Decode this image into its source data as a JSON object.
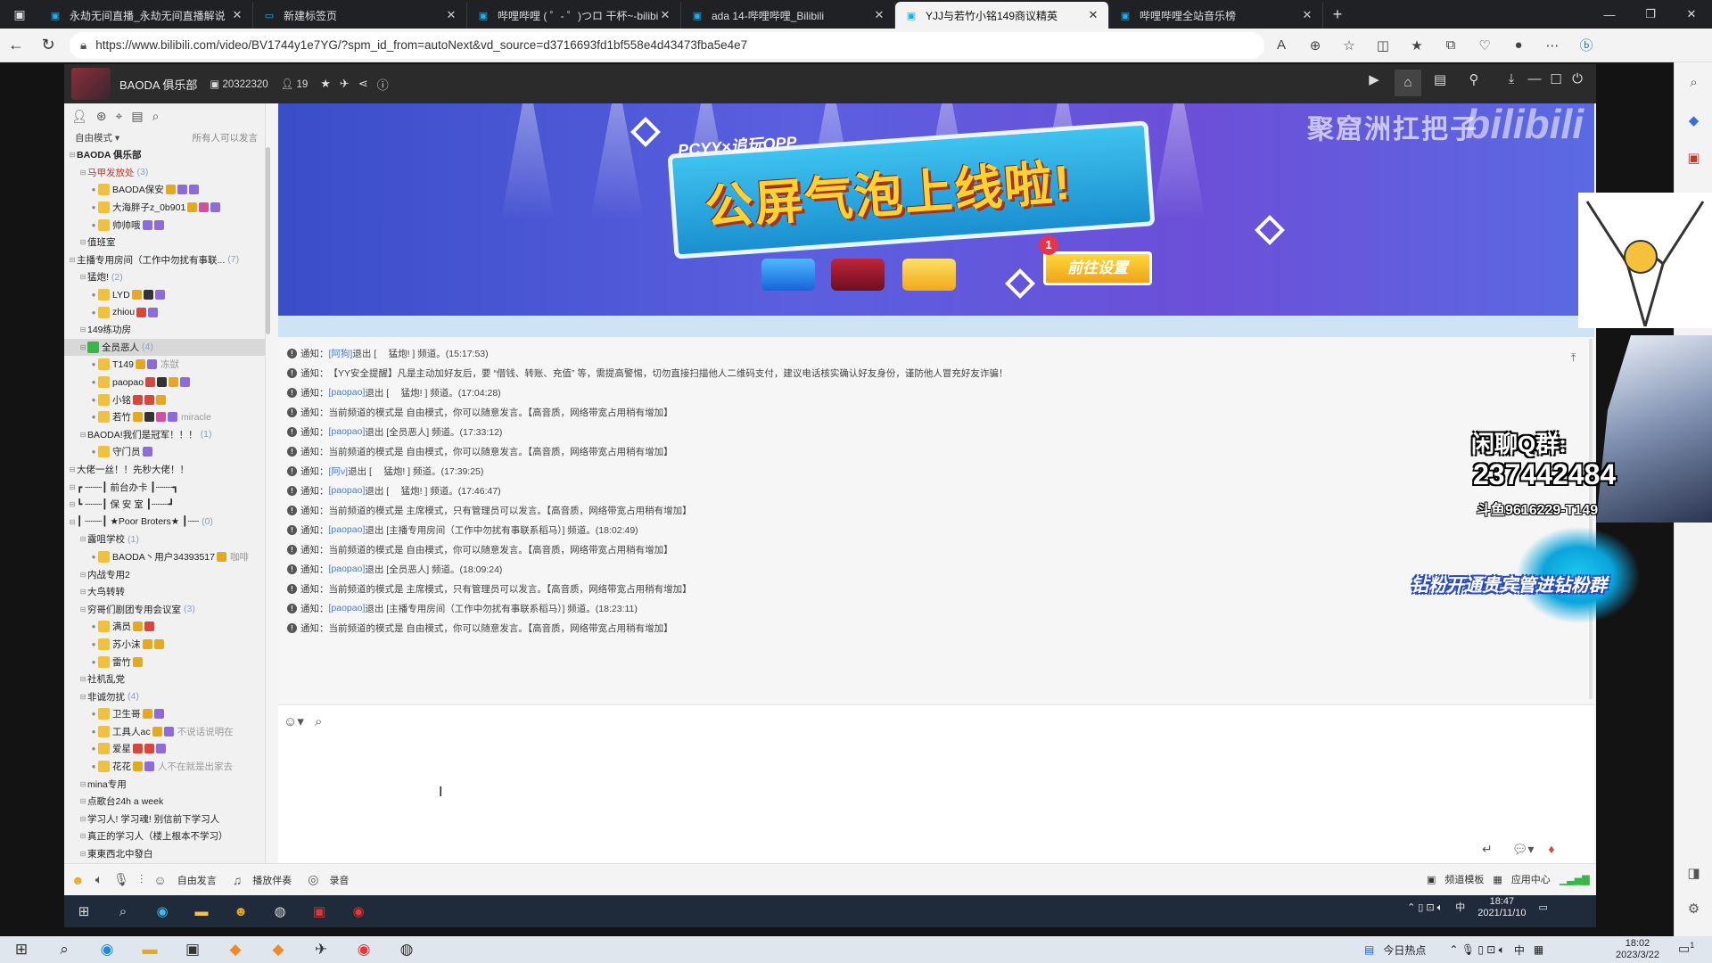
{
  "browser": {
    "tabs": [
      {
        "title": "永劫无间直播_永劫无间直播解说",
        "active": false
      },
      {
        "title": "新建标签页",
        "active": false
      },
      {
        "title": "哔哩哔哩 ( ゜- ゜)つロ 干杯~-bilibili",
        "active": false
      },
      {
        "title": "ada 14-哔哩哔哩_Bilibili",
        "active": false
      },
      {
        "title": "YJJ与若竹小铭149商议精英",
        "active": true
      },
      {
        "title": "哔哩哔哩全站音乐榜",
        "active": false
      }
    ],
    "url": "https://www.bilibili.com/video/BV1744y1e7YG/?spm_id_from=autoNext&vd_source=d3716693fd1bf558e4d43473fba5e4e7"
  },
  "yy": {
    "channel_name": "BAODA 俱乐部",
    "channel_id": "20322320",
    "online_count": "19",
    "mode": "自由模式",
    "mode_note": "所有人可以发言",
    "tree": [
      {
        "label": "BAODA 俱乐部",
        "level": 0,
        "bold": true
      },
      {
        "label": "马甲发放处",
        "level": 1,
        "count": "(3)",
        "red": true
      },
      {
        "label": "BAODA保安",
        "level": 2,
        "user": true,
        "badges": [
          "g",
          "v",
          "v"
        ]
      },
      {
        "label": "大海胖子z_0b901",
        "level": 2,
        "user": true,
        "badges": [
          "g",
          "p",
          "v"
        ]
      },
      {
        "label": "帅帅哦",
        "level": 2,
        "user": true,
        "badges": [
          "v",
          "v"
        ]
      },
      {
        "label": "值班室",
        "level": 1
      },
      {
        "label": "主播专用房间（工作中勿扰有事联...",
        "level": 0,
        "count": "(7)"
      },
      {
        "label": "猛炮!",
        "level": 1,
        "count": "(2)"
      },
      {
        "label": "LYD",
        "level": 2,
        "user": true,
        "badges": [
          "g",
          "b",
          "v"
        ]
      },
      {
        "label": "zhiou",
        "level": 2,
        "user": true,
        "badges": [
          "r",
          "v"
        ]
      },
      {
        "label": "149练功房",
        "level": 1
      },
      {
        "label": "全员恶人",
        "level": 1,
        "count": "(4)",
        "selected": true
      },
      {
        "label": "T149",
        "level": 2,
        "user": true,
        "badges": [
          "g",
          "v"
        ],
        "extra": "冻獃"
      },
      {
        "label": "paopao",
        "level": 2,
        "user": true,
        "badges": [
          "r",
          "b",
          "g",
          "v"
        ]
      },
      {
        "label": "小铭",
        "level": 2,
        "user": true,
        "badges": [
          "r",
          "r",
          "g"
        ]
      },
      {
        "label": "若竹",
        "level": 2,
        "user": true,
        "badges": [
          "g",
          "b",
          "p",
          "v"
        ],
        "extra": "miracle"
      },
      {
        "label": "BAODA!我们是冠军！！！",
        "level": 1,
        "count": "(1)"
      },
      {
        "label": "守门员",
        "level": 2,
        "user": true,
        "badges": [
          "v"
        ]
      },
      {
        "label": "大佬一丝！！先秒大佬！！",
        "level": 0
      },
      {
        "label": "┏ ┄┄┄┃ 前台办卡 ┃┄┄┄┓",
        "level": 0
      },
      {
        "label": "┗ ┄┄┄┃ 保 安 室 ┃┄┄┄┛",
        "level": 0
      },
      {
        "label": "┃ ┄┄┄┃ ★Poor Broters★ ┃┄┄",
        "level": 0,
        "count": "(0)"
      },
      {
        "label": "露咀学校",
        "level": 1,
        "count": "(1)"
      },
      {
        "label": "BAODA丶用户34393517",
        "level": 2,
        "user": true,
        "badges": [
          "g"
        ],
        "extra": "咖啡"
      },
      {
        "label": "内战专用2",
        "level": 1
      },
      {
        "label": "大鸟转转",
        "level": 1
      },
      {
        "label": "穷哥们剧团专用会议室",
        "level": 1,
        "count": "(3)"
      },
      {
        "label": "满员",
        "level": 2,
        "user": true,
        "badges": [
          "g",
          "r"
        ]
      },
      {
        "label": "苏小沫",
        "level": 2,
        "user": true,
        "badges": [
          "g",
          "g"
        ]
      },
      {
        "label": "雷竹",
        "level": 2,
        "user": true,
        "badges": [
          "g"
        ]
      },
      {
        "label": "社机乱党",
        "level": 1
      },
      {
        "label": "非诚勿扰",
        "level": 1,
        "count": "(4)"
      },
      {
        "label": "卫生哥",
        "level": 2,
        "user": true,
        "badges": [
          "g",
          "v"
        ]
      },
      {
        "label": "工具人ac",
        "level": 2,
        "user": true,
        "badges": [
          "g",
          "v"
        ],
        "extra": "不说话说明在"
      },
      {
        "label": "爱星",
        "level": 2,
        "user": true,
        "badges": [
          "r",
          "r",
          "v"
        ]
      },
      {
        "label": "花花",
        "level": 2,
        "user": true,
        "badges": [
          "g",
          "v"
        ],
        "extra": "人不在就是出家去"
      },
      {
        "label": "mina专用",
        "level": 1
      },
      {
        "label": "点歌台24h a week",
        "level": 1
      },
      {
        "label": "学习人! 学习魂! 别信前下学习人",
        "level": 1
      },
      {
        "label": "真正的学习人（楼上根本不学习）",
        "level": 1
      },
      {
        "label": "東東西北中發白",
        "level": 1
      }
    ],
    "banner": {
      "sub": "PCYY×追玩OPP",
      "headline": "公屏气泡上线啦!",
      "button": "前往设置",
      "dot": "1",
      "brand": "聚窟洲扛把子",
      "logo": "bilibili"
    },
    "messages": [
      {
        "prefix": "通知：",
        "user": "[阿狗]",
        "text": " 退出 [ 　猛炮! ] 频道。(15:17:53)"
      },
      {
        "prefix": "通知：",
        "user": "",
        "text": "【YY安全提醒】凡是主动加好友后，要 “借钱、转账、充值” 等，需提高警惕，切勿直接扫描他人二维码支付，建议电话核实确认好友身份，谨防他人冒充好友诈骗！"
      },
      {
        "prefix": "通知：",
        "user": "[paopao]",
        "text": " 退出 [ 　猛炮! ] 频道。(17:04:28)"
      },
      {
        "prefix": "通知：",
        "user": "",
        "text": "当前频道的模式是 自由模式，你可以随意发言。【高音质，网络带宽占用稍有增加】"
      },
      {
        "prefix": "通知：",
        "user": "[paopao]",
        "text": " 退出 [全员恶人] 频道。(17:33:12)"
      },
      {
        "prefix": "通知：",
        "user": "",
        "text": "当前频道的模式是 自由模式，你可以随意发言。【高音质，网络带宽占用稍有增加】"
      },
      {
        "prefix": "通知：",
        "user": "[阿ν]",
        "text": " 退出 [ 　猛炮! ] 频道。(17:39:25)"
      },
      {
        "prefix": "通知：",
        "user": "[paopao]",
        "text": " 退出 [ 　猛炮! ] 频道。(17:46:47)"
      },
      {
        "prefix": "通知：",
        "user": "",
        "text": "当前频道的模式是 主席模式，只有管理员可以发言。【高音质，网络带宽占用稍有增加】"
      },
      {
        "prefix": "通知：",
        "user": "[paopao]",
        "text": " 退出 [主播专用房间（工作中勿扰有事联系稻马）] 频道。(18:02:49)"
      },
      {
        "prefix": "通知：",
        "user": "",
        "text": "当前频道的模式是 自由模式，你可以随意发言。【高音质，网络带宽占用稍有增加】"
      },
      {
        "prefix": "通知：",
        "user": "[paopao]",
        "text": " 退出 [全员恶人] 频道。(18:09:24)"
      },
      {
        "prefix": "通知：",
        "user": "",
        "text": "当前频道的模式是 主席模式，只有管理员可以发言。【高音质，网络带宽占用稍有增加】"
      },
      {
        "prefix": "通知：",
        "user": "[paopao]",
        "text": " 退出 [主播专用房间（工作中勿扰有事联系稻马）] 频道。(18:23:11)"
      },
      {
        "prefix": "通知：",
        "user": "",
        "text": "当前频道的模式是 自由模式，你可以随意发言。【高音质，网络带宽占用稍有增加】"
      }
    ],
    "bottom": {
      "free_speak": "自由发言",
      "play_music": "播放伴奏",
      "record": "录音",
      "channel_template": "频道模板",
      "app_center": "应用中心"
    },
    "inner_clock": {
      "time": "18:47",
      "date": "2021/11/10",
      "ime": "中"
    }
  },
  "overlay": {
    "qq_label": "闲聊Q群:",
    "qq_number": "237442484",
    "douyu": "斗鱼9616229-T149",
    "promo": "钻粉开通贵宾管进钻粉群"
  },
  "taskbar": {
    "news": "今日热点",
    "ime": "中",
    "time": "18:02",
    "date": "2023/3/22",
    "notif": "1"
  },
  "colors": {
    "accent": "#23ade5",
    "chat_user": "#4a7bd0",
    "banner_title": "#ffd234"
  }
}
